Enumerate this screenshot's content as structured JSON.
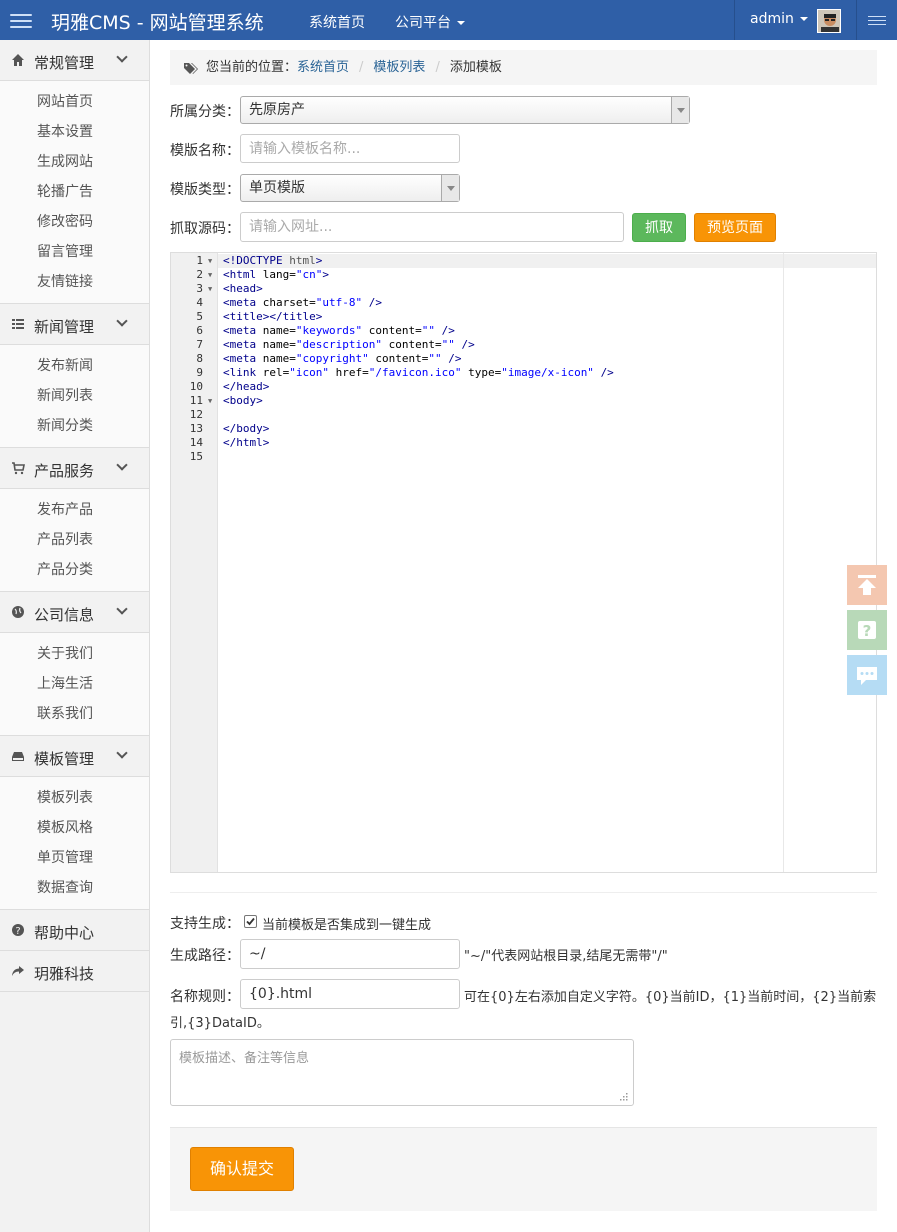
{
  "app": {
    "title": "玥雅CMS - 网站管理系统"
  },
  "topnav": {
    "home": "系统首页",
    "platform": "公司平台",
    "user": "admin"
  },
  "sidebar": {
    "sections": [
      {
        "label": "常规管理",
        "icon": "home-icon",
        "items": [
          "网站首页",
          "基本设置",
          "生成网站",
          "轮播广告",
          "修改密码",
          "留言管理",
          "友情链接"
        ]
      },
      {
        "label": "新闻管理",
        "icon": "list-icon",
        "items": [
          "发布新闻",
          "新闻列表",
          "新闻分类"
        ]
      },
      {
        "label": "产品服务",
        "icon": "cart-icon",
        "items": [
          "发布产品",
          "产品列表",
          "产品分类"
        ]
      },
      {
        "label": "公司信息",
        "icon": "globe-icon",
        "items": [
          "关于我们",
          "上海生活",
          "联系我们"
        ]
      },
      {
        "label": "模板管理",
        "icon": "hdd-icon",
        "items": [
          "模板列表",
          "模板风格",
          "单页管理",
          "数据查询"
        ]
      },
      {
        "label": "帮助中心",
        "icon": "question-icon",
        "items": []
      },
      {
        "label": "玥雅科技",
        "icon": "share-icon",
        "items": []
      }
    ]
  },
  "breadcrumb": {
    "prefix": "您当前的位置：",
    "home": "系统首页",
    "list": "模板列表",
    "current": "添加模板"
  },
  "form": {
    "category_label": "所属分类：",
    "category_value": "先原房产",
    "name_label": "模版名称：",
    "name_placeholder": "请输入模板名称...",
    "type_label": "模版类型：",
    "type_value": "单页模版",
    "source_label": "抓取源码：",
    "source_placeholder": "请输入网址...",
    "fetch_button": "抓取",
    "preview_button": "预览页面",
    "gen_label": "支持生成：",
    "gen_checkbox": "当前模板是否集成到一键生成",
    "path_label": "生成路径：",
    "path_value": "~/",
    "path_note": "\"~/\"代表网站根目录,结尾无需带\"/\"",
    "rule_label": "名称规则：",
    "rule_value": "{0}.html",
    "rule_note_1": "可在{0}左右添加自定义字符。{0}当前ID，{1}当前时间，{2}当前索",
    "rule_note_2": "引,{3}DataID。",
    "desc_placeholder": "模板描述、备注等信息",
    "submit": "确认提交"
  },
  "editor": {
    "lines": [
      "<!DOCTYPE html>",
      "<html lang=\"cn\">",
      "<head>",
      "<meta charset=\"utf-8\" />",
      "<title></title>",
      "<meta name=\"keywords\" content=\"\" />",
      "<meta name=\"description\" content=\"\" />",
      "<meta name=\"copyright\" content=\"\" />",
      "<link rel=\"icon\" href=\"/favicon.ico\" type=\"image/x-icon\" />",
      "</head>",
      "<body>",
      "",
      "</body>",
      "</html>",
      ""
    ],
    "line_numbers": [
      "1",
      "2",
      "3",
      "4",
      "5",
      "6",
      "7",
      "8",
      "9",
      "10",
      "11",
      "12",
      "13",
      "14",
      "15"
    ]
  },
  "colors": {
    "topbar": "#2f5fa7",
    "fetch": "#5cb85c",
    "preview": "#f89406",
    "link": "#2a6496"
  }
}
